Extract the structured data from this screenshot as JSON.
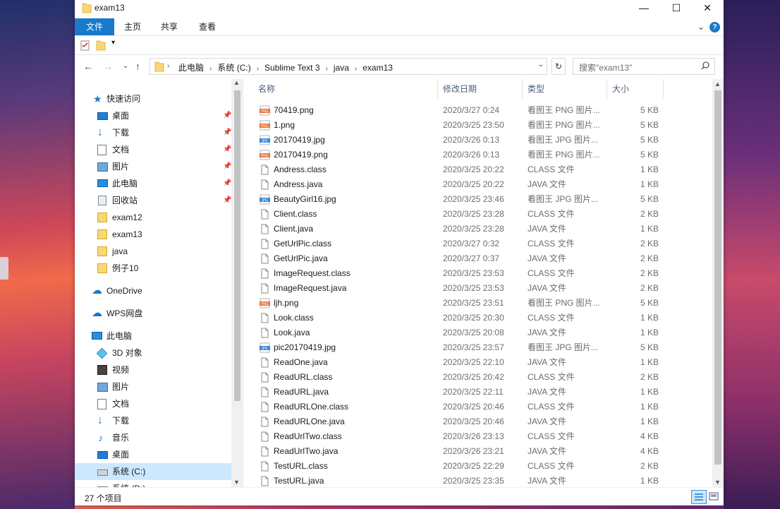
{
  "window": {
    "title": "exam13",
    "minimize_glyph": "—",
    "maximize_glyph": "☐",
    "close_glyph": "✕"
  },
  "ribbon": {
    "tabs": [
      "文件",
      "主页",
      "共享",
      "查看"
    ],
    "expand_glyph": "⌄",
    "help_glyph": "?"
  },
  "address": {
    "crumbs": [
      "此电脑",
      "系统 (C:)",
      "Sublime Text 3",
      "java",
      "exam13"
    ],
    "separator": "›",
    "search_placeholder": "搜索\"exam13\""
  },
  "navigation": {
    "quick_access": "快速访问",
    "quick_items": [
      {
        "label": "桌面",
        "icon": "desktop-icon"
      },
      {
        "label": "下载",
        "icon": "download-icon"
      },
      {
        "label": "文档",
        "icon": "document-icon"
      },
      {
        "label": "图片",
        "icon": "picture-icon"
      },
      {
        "label": "此电脑",
        "icon": "computer-icon"
      },
      {
        "label": "回收站",
        "icon": "recycle-bin-icon"
      },
      {
        "label": "exam12",
        "icon": "folder-icon"
      },
      {
        "label": "exam13",
        "icon": "folder-icon"
      },
      {
        "label": "java",
        "icon": "folder-icon"
      },
      {
        "label": "例子10",
        "icon": "folder-icon"
      }
    ],
    "onedrive": "OneDrive",
    "wps": "WPS网盘",
    "this_pc": "此电脑",
    "pc_items": [
      {
        "label": "3D 对象",
        "icon": "3d-objects-icon"
      },
      {
        "label": "视频",
        "icon": "video-icon"
      },
      {
        "label": "图片",
        "icon": "picture-icon"
      },
      {
        "label": "文档",
        "icon": "document-icon"
      },
      {
        "label": "下载",
        "icon": "download-icon"
      },
      {
        "label": "音乐",
        "icon": "music-icon"
      },
      {
        "label": "桌面",
        "icon": "desktop-icon"
      },
      {
        "label": "系统 (C:)",
        "icon": "drive-icon"
      },
      {
        "label": "系统 (D:)",
        "icon": "drive-icon"
      }
    ]
  },
  "columns": {
    "name": "名称",
    "date": "修改日期",
    "type": "类型",
    "size": "大小"
  },
  "files": [
    {
      "name": "70419.png",
      "date": "2020/3/27 0:24",
      "type": "看图王 PNG 图片...",
      "size": "5 KB",
      "icon": "png"
    },
    {
      "name": "1.png",
      "date": "2020/3/25 23:50",
      "type": "看图王 PNG 图片...",
      "size": "5 KB",
      "icon": "png"
    },
    {
      "name": "20170419.jpg",
      "date": "2020/3/26 0:13",
      "type": "看图王 JPG 图片...",
      "size": "5 KB",
      "icon": "jpg"
    },
    {
      "name": "20170419.png",
      "date": "2020/3/26 0:13",
      "type": "看图王 PNG 图片...",
      "size": "5 KB",
      "icon": "png"
    },
    {
      "name": "Andress.class",
      "date": "2020/3/25 20:22",
      "type": "CLASS 文件",
      "size": "1 KB",
      "icon": "file"
    },
    {
      "name": "Andress.java",
      "date": "2020/3/25 20:22",
      "type": "JAVA 文件",
      "size": "1 KB",
      "icon": "file"
    },
    {
      "name": "BeautyGirl16.jpg",
      "date": "2020/3/25 23:46",
      "type": "看图王 JPG 图片...",
      "size": "5 KB",
      "icon": "jpg"
    },
    {
      "name": "Client.class",
      "date": "2020/3/25 23:28",
      "type": "CLASS 文件",
      "size": "2 KB",
      "icon": "file"
    },
    {
      "name": "Client.java",
      "date": "2020/3/25 23:28",
      "type": "JAVA 文件",
      "size": "1 KB",
      "icon": "file"
    },
    {
      "name": "GetUrlPic.class",
      "date": "2020/3/27 0:32",
      "type": "CLASS 文件",
      "size": "2 KB",
      "icon": "file"
    },
    {
      "name": "GetUrlPic.java",
      "date": "2020/3/27 0:37",
      "type": "JAVA 文件",
      "size": "2 KB",
      "icon": "file"
    },
    {
      "name": "ImageRequest.class",
      "date": "2020/3/25 23:53",
      "type": "CLASS 文件",
      "size": "2 KB",
      "icon": "file"
    },
    {
      "name": "ImageRequest.java",
      "date": "2020/3/25 23:53",
      "type": "JAVA 文件",
      "size": "2 KB",
      "icon": "file"
    },
    {
      "name": "ljh.png",
      "date": "2020/3/25 23:51",
      "type": "看图王 PNG 图片...",
      "size": "5 KB",
      "icon": "png"
    },
    {
      "name": "Look.class",
      "date": "2020/3/25 20:30",
      "type": "CLASS 文件",
      "size": "1 KB",
      "icon": "file"
    },
    {
      "name": "Look.java",
      "date": "2020/3/25 20:08",
      "type": "JAVA 文件",
      "size": "1 KB",
      "icon": "file"
    },
    {
      "name": "pic20170419.jpg",
      "date": "2020/3/25 23:57",
      "type": "看图王 JPG 图片...",
      "size": "5 KB",
      "icon": "jpg"
    },
    {
      "name": "ReadOne.java",
      "date": "2020/3/25 22:10",
      "type": "JAVA 文件",
      "size": "1 KB",
      "icon": "file"
    },
    {
      "name": "ReadURL.class",
      "date": "2020/3/25 20:42",
      "type": "CLASS 文件",
      "size": "2 KB",
      "icon": "file"
    },
    {
      "name": "ReadURL.java",
      "date": "2020/3/25 22:11",
      "type": "JAVA 文件",
      "size": "1 KB",
      "icon": "file"
    },
    {
      "name": "ReadURLOne.class",
      "date": "2020/3/25 20:46",
      "type": "CLASS 文件",
      "size": "1 KB",
      "icon": "file"
    },
    {
      "name": "ReadURLOne.java",
      "date": "2020/3/25 20:46",
      "type": "JAVA 文件",
      "size": "1 KB",
      "icon": "file"
    },
    {
      "name": "ReadUrlTwo.class",
      "date": "2020/3/26 23:13",
      "type": "CLASS 文件",
      "size": "4 KB",
      "icon": "file"
    },
    {
      "name": "ReadUrlTwo.java",
      "date": "2020/3/26 23:21",
      "type": "JAVA 文件",
      "size": "4 KB",
      "icon": "file"
    },
    {
      "name": "TestURL.class",
      "date": "2020/3/25 22:29",
      "type": "CLASS 文件",
      "size": "2 KB",
      "icon": "file"
    },
    {
      "name": "TestURL.java",
      "date": "2020/3/25 23:35",
      "type": "JAVA 文件",
      "size": "1 KB",
      "icon": "file"
    }
  ],
  "status": {
    "item_count": "27 个项目"
  },
  "colors": {
    "accent": "#1979ca",
    "selected": "#cce8ff",
    "folder": "#f8d775"
  }
}
